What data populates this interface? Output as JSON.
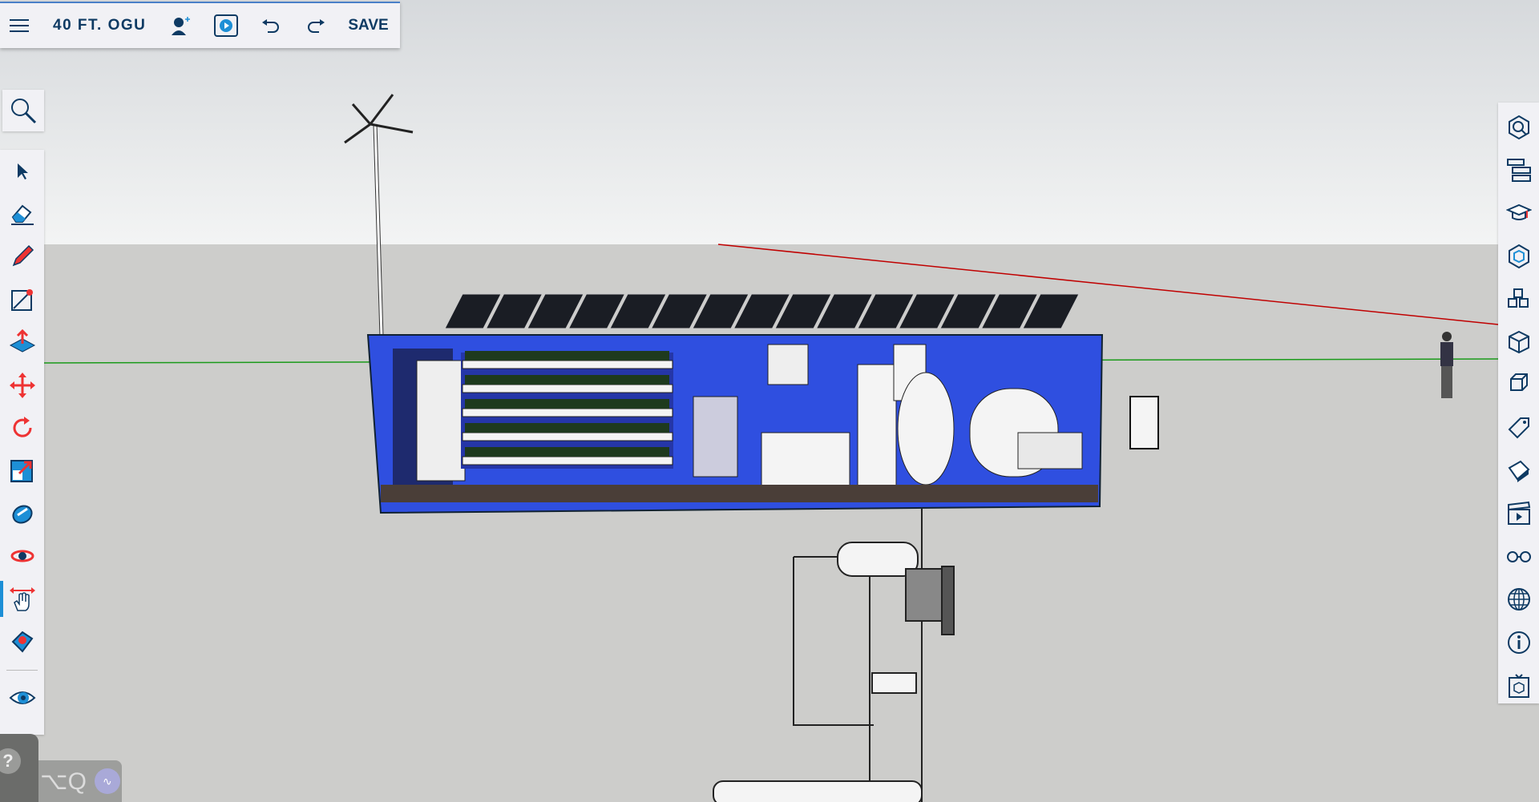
{
  "toolbar": {
    "title": "40 FT. OGU",
    "save_label": "SAVE"
  },
  "left_tools": [
    "select",
    "eraser",
    "pencil",
    "tape-measure",
    "push-pull",
    "move",
    "rotate",
    "scale",
    "paint-bucket",
    "orbit",
    "pan",
    "position-camera",
    "walk"
  ],
  "right_tools": [
    "search-3d-warehouse",
    "outliner",
    "instructor",
    "components",
    "materials",
    "solid-inspector",
    "entity-info",
    "tags",
    "styles",
    "scenes",
    "display",
    "shadows",
    "model-info",
    "extension"
  ],
  "help": {
    "label": "?"
  },
  "shortcut": {
    "label": "⌥Q"
  },
  "colors": {
    "accent": "#1d8fd6",
    "container": "#2f4fe0",
    "axis_red": "#c00000",
    "axis_green": "#1a9a1a"
  }
}
